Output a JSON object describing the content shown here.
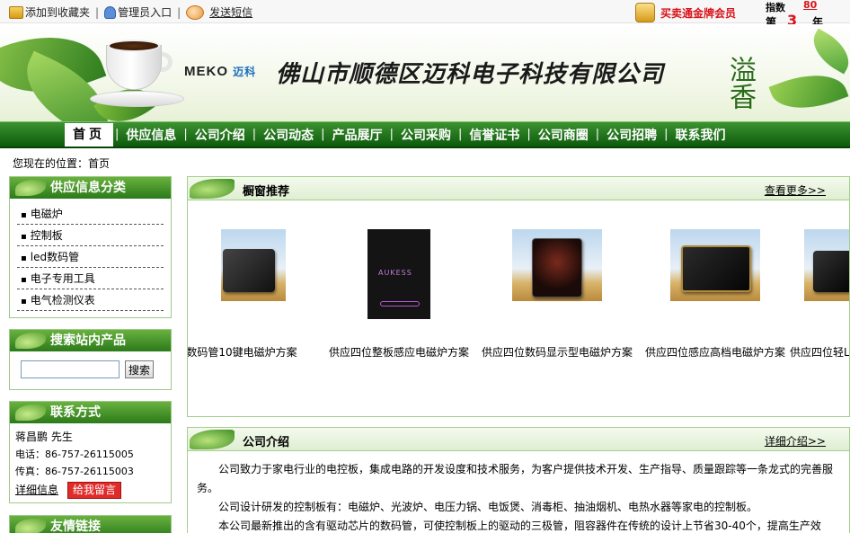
{
  "topbar": {
    "add_favorite": "添加到收藏夹",
    "admin_entry": "管理员入口",
    "send_sms": "发送短信",
    "gold_member": "买卖通金牌会员",
    "index_label": "指数",
    "index_value": "80",
    "rank_prefix": "第",
    "rank_value": "3",
    "rank_suffix": "年"
  },
  "banner": {
    "logo_text": "MEKO",
    "logo_cn": "迈科",
    "company_name": "佛山市顺德区迈科电子科技有限公司",
    "calligraphy": "溢香",
    "dots": "……"
  },
  "nav": {
    "items": [
      "首页",
      "供应信息",
      "公司介绍",
      "公司动态",
      "产品展厅",
      "公司采购",
      "信誉证书",
      "公司商圈",
      "公司招聘",
      "联系我们"
    ]
  },
  "breadcrumb": "您现在的位置：首页",
  "sidebar": {
    "categories_title": "供应信息分类",
    "categories": [
      "电磁炉",
      "控制板",
      "led数码管",
      "电子专用工具",
      "电气检测仪表"
    ],
    "search_title": "搜索站内产品",
    "search_button": "搜索",
    "search_value": "",
    "contact_title": "联系方式",
    "contact_name": "蒋昌鹏 先生",
    "phone": "电话：86-757-26115005",
    "fax": "传真：86-757-26115003",
    "detail_link": "详细信息",
    "message_button": "给我留言",
    "links_title": "友情链接"
  },
  "showcase": {
    "title": "橱窗推荐",
    "more": "查看更多>>",
    "products": [
      {
        "caption": "数码管10键电磁炉方案"
      },
      {
        "caption": "供应四位整板感应电磁炉方案"
      },
      {
        "caption": "供应四位数码显示型电磁炉方案"
      },
      {
        "caption": "供应四位感应高档电磁炉方案"
      },
      {
        "caption": "供应四位轻L"
      }
    ],
    "product_image_label": "AUKESS"
  },
  "company_intro": {
    "title": "公司介绍",
    "more": "详细介绍>>",
    "paragraphs": [
      "公司致力于家电行业的电控板，集成电路的开发设度和技术服务，为客户提供技术开发、生产指导、质量跟踪等一条龙式的完善服务。",
      "公司设计研发的控制板有：电磁炉、光波炉、电压力锅、电饭煲、消毒柜、抽油烟机、电热水器等家电的控制板。",
      "本公司最新推出的含有驱动芯片的数码管，可使控制板上的驱动的三极管，阻容器件在传统的设计上节省30-40个，提高生产效率，"
    ]
  },
  "colors": {
    "nav_green": "#0d5a0c",
    "accent_red": "#d8131a"
  }
}
